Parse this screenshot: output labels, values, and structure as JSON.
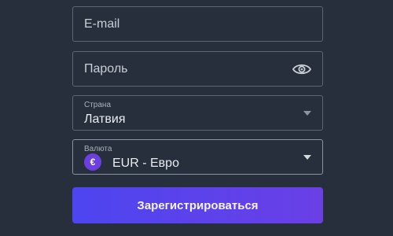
{
  "form": {
    "email": {
      "placeholder": "E-mail"
    },
    "password": {
      "placeholder": "Пароль",
      "toggle_icon": "eye-icon"
    },
    "country": {
      "label": "Страна",
      "value": "Латвия",
      "icon": "chevron-down-icon"
    },
    "currency": {
      "label": "Валюта",
      "value": "EUR - Евро",
      "symbol": "€",
      "symbol_color": "#6b3fe0",
      "icon": "chevron-down-icon"
    },
    "submit": {
      "label": "Зарегистрироваться",
      "color_start": "#4d45f0",
      "color_end": "#6a3fe6"
    }
  }
}
